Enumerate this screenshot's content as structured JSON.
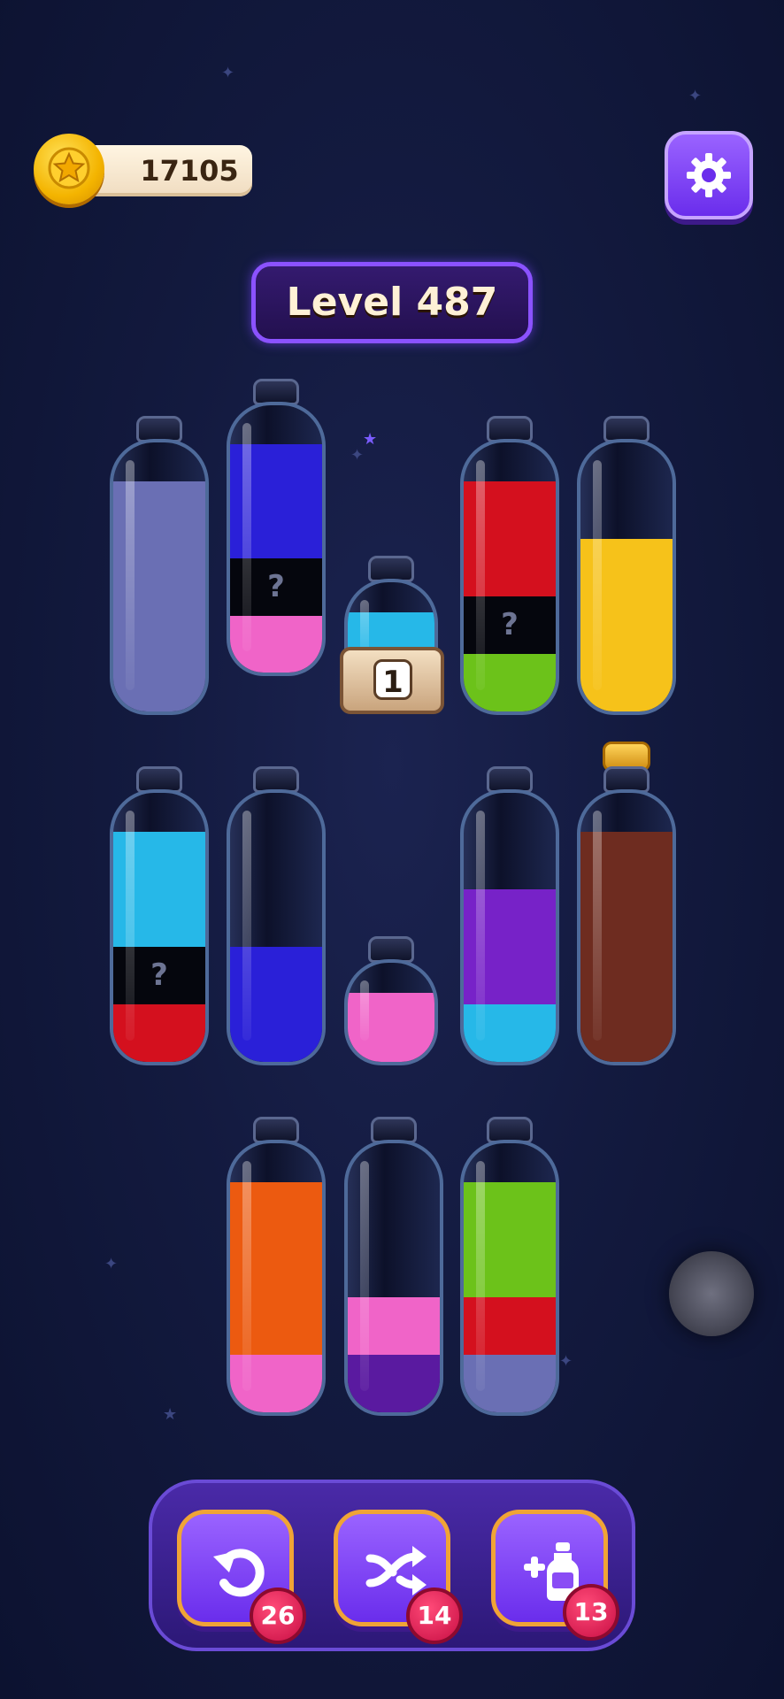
{
  "hud": {
    "coins": "17105",
    "level_label": "Level 487"
  },
  "icons": {
    "coin": "star-coin-icon",
    "settings": "gear-icon",
    "undo": "undo-icon",
    "shuffle": "shuffle-icon",
    "add_bottle": "add-bottle-icon"
  },
  "colors": {
    "periwinkle": "#6a6fb4",
    "blue": "#2a20d8",
    "pink": "#f064c8",
    "red": "#d4101e",
    "green": "#6cc21a",
    "yellow": "#f6c21a",
    "cyan": "#26b8e8",
    "purple": "#7722c8",
    "brown": "#6e2c20",
    "orange": "#ec5a10",
    "dark_purple": "#5a1aa0",
    "unknown": "#05060d"
  },
  "bottles": [
    {
      "id": "bottle-1",
      "capacity": 4,
      "layers": [
        {
          "color": "periwinkle",
          "units": 4
        }
      ]
    },
    {
      "id": "bottle-2",
      "capacity": 4,
      "layers": [
        {
          "color": "pink",
          "units": 1
        },
        {
          "color": "unknown",
          "units": 1,
          "label": "?"
        },
        {
          "color": "blue",
          "units": 2
        }
      ]
    },
    {
      "id": "bottle-3-small",
      "capacity": 1,
      "layers": [
        {
          "color": "cyan",
          "units": 1
        }
      ],
      "locked_count": "1"
    },
    {
      "id": "bottle-4",
      "capacity": 4,
      "layers": [
        {
          "color": "green",
          "units": 1
        },
        {
          "color": "unknown",
          "units": 1,
          "label": "?"
        },
        {
          "color": "red",
          "units": 2
        }
      ]
    },
    {
      "id": "bottle-5",
      "capacity": 4,
      "layers": [
        {
          "color": "yellow",
          "units": 3
        }
      ]
    },
    {
      "id": "bottle-6",
      "capacity": 4,
      "layers": [
        {
          "color": "red",
          "units": 1
        },
        {
          "color": "unknown",
          "units": 1,
          "label": "?"
        },
        {
          "color": "cyan",
          "units": 2
        }
      ]
    },
    {
      "id": "bottle-7",
      "capacity": 4,
      "layers": [
        {
          "color": "blue",
          "units": 2
        }
      ]
    },
    {
      "id": "bottle-8-small",
      "capacity": 1,
      "layers": [
        {
          "color": "pink",
          "units": 1
        }
      ]
    },
    {
      "id": "bottle-9",
      "capacity": 4,
      "layers": [
        {
          "color": "cyan",
          "units": 1
        },
        {
          "color": "purple",
          "units": 2
        }
      ]
    },
    {
      "id": "bottle-10",
      "capacity": 4,
      "layers": [
        {
          "color": "brown",
          "units": 4
        }
      ],
      "corked": true
    },
    {
      "id": "bottle-11",
      "capacity": 4,
      "layers": [
        {
          "color": "pink",
          "units": 1
        },
        {
          "color": "orange",
          "units": 3
        }
      ]
    },
    {
      "id": "bottle-12",
      "capacity": 4,
      "layers": [
        {
          "color": "dark_purple",
          "units": 1
        },
        {
          "color": "pink",
          "units": 1
        }
      ]
    },
    {
      "id": "bottle-13",
      "capacity": 4,
      "layers": [
        {
          "color": "periwinkle",
          "units": 1
        },
        {
          "color": "red",
          "units": 1
        },
        {
          "color": "green",
          "units": 2
        }
      ]
    }
  ],
  "toolbar": {
    "undo_count": "26",
    "shuffle_count": "14",
    "add_bottle_count": "13"
  }
}
